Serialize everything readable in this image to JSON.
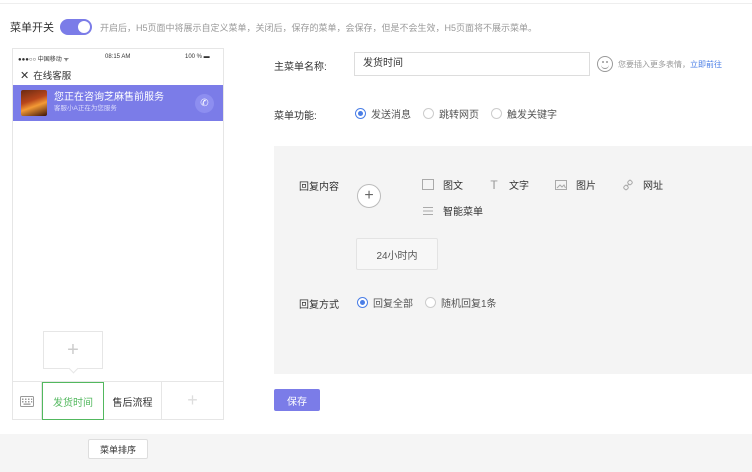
{
  "header": {
    "toggle_label": "菜单开关",
    "toggle_on": true,
    "toggle_desc": "开启后，H5页面中将展示自定义菜单，关闭后，保存的菜单，会保存，但是不会生效，H5页面将不展示菜单。"
  },
  "phone": {
    "status": {
      "carrier": "●●●○○ 中国移动 ᯤ",
      "time": "08:15 AM",
      "battery": "100 % ▬"
    },
    "title": "在线客服",
    "banner": {
      "title": "您正在咨询芝麻售前服务",
      "subtitle": "客服小A正在为您服务"
    },
    "menu": {
      "item1": "发货时间",
      "item2": "售后流程"
    }
  },
  "form": {
    "menu_name_label": "主菜单名称:",
    "menu_name_value": "发货时间",
    "hint": "您要插入更多表情，",
    "hint_link": "立即前往",
    "function_label": "菜单功能:",
    "function_options": [
      "发送消息",
      "跳转网页",
      "触发关键字"
    ],
    "function_selected": 0,
    "reply_label": "回复内容",
    "content_types": [
      "图文",
      "文字",
      "图片",
      "网址",
      "智能菜单"
    ],
    "chip": "24小时内",
    "reply_mode_label": "回复方式",
    "reply_mode_options": [
      "回复全部",
      "随机回复1条"
    ],
    "reply_mode_selected": 0,
    "save_label": "保存"
  },
  "footer": {
    "sort_label": "菜单排序"
  },
  "colors": {
    "accent": "#7b7ce8",
    "link": "#4a7ee6",
    "active_green": "#52b85e"
  }
}
